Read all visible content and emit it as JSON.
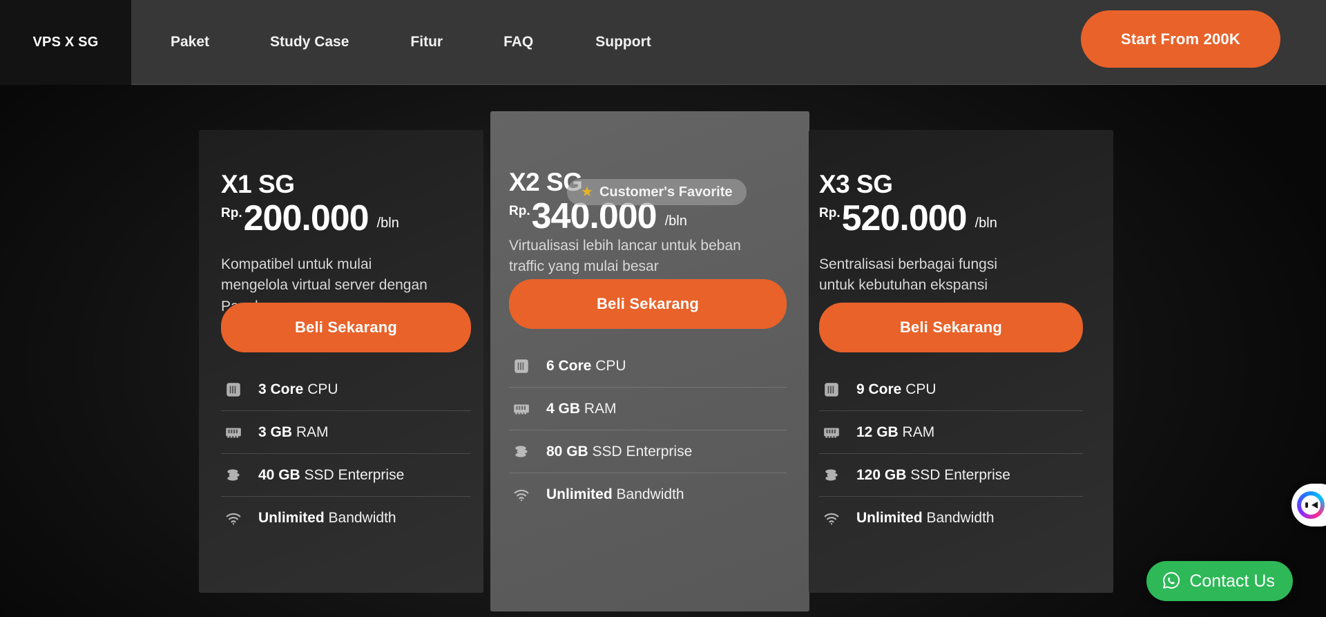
{
  "navbar": {
    "brand": "VPS X SG",
    "links": [
      "Paket",
      "Study Case",
      "Fitur",
      "FAQ",
      "Support"
    ],
    "cta_label": "Start From 200K",
    "cta_color": "#e8622a"
  },
  "badge": {
    "icon": "star-icon",
    "star_glyph": "★",
    "label": "Customer's Favorite",
    "star_color": "#e8b423"
  },
  "plans": [
    {
      "name": "X1 SG",
      "currency": "Rp.",
      "price": "200.000",
      "period": "/bln",
      "description": "Kompatibel untuk mulai mengelola virtual server dengan Panel",
      "cta_label": "Beli Sekarang",
      "highlighted": false,
      "features": [
        {
          "icon": "cpu-icon",
          "value": "3 Core",
          "label": "CPU"
        },
        {
          "icon": "ram-icon",
          "value": "3 GB",
          "label": "RAM"
        },
        {
          "icon": "storage-icon",
          "value": "40 GB",
          "label": "SSD Enterprise"
        },
        {
          "icon": "bandwidth-icon",
          "value": "Unlimited",
          "label": "Bandwidth"
        }
      ]
    },
    {
      "name": "X2 SG",
      "currency": "Rp.",
      "price": "340.000",
      "period": "/bln",
      "description": "Virtualisasi lebih lancar untuk beban traffic yang mulai besar",
      "cta_label": "Beli Sekarang",
      "highlighted": true,
      "features": [
        {
          "icon": "cpu-icon",
          "value": "6 Core",
          "label": "CPU"
        },
        {
          "icon": "ram-icon",
          "value": "4 GB",
          "label": "RAM"
        },
        {
          "icon": "storage-icon",
          "value": "80 GB",
          "label": "SSD Enterprise"
        },
        {
          "icon": "bandwidth-icon",
          "value": "Unlimited",
          "label": "Bandwidth"
        }
      ]
    },
    {
      "name": "X3 SG",
      "currency": "Rp.",
      "price": "520.000",
      "period": "/bln",
      "description": "Sentralisasi berbagai fungsi untuk kebutuhan ekspansi",
      "cta_label": "Beli Sekarang",
      "highlighted": false,
      "features": [
        {
          "icon": "cpu-icon",
          "value": "9 Core",
          "label": "CPU"
        },
        {
          "icon": "ram-icon",
          "value": "12 GB",
          "label": "RAM"
        },
        {
          "icon": "storage-icon",
          "value": "120 GB",
          "label": "SSD Enterprise"
        },
        {
          "icon": "bandwidth-icon",
          "value": "Unlimited",
          "label": "Bandwidth"
        }
      ]
    }
  ],
  "floating": {
    "chat_widget_icon": "chat-avatar-icon",
    "contact": {
      "icon": "whatsapp-icon",
      "label": "Contact Us",
      "color": "#2eb858"
    }
  }
}
